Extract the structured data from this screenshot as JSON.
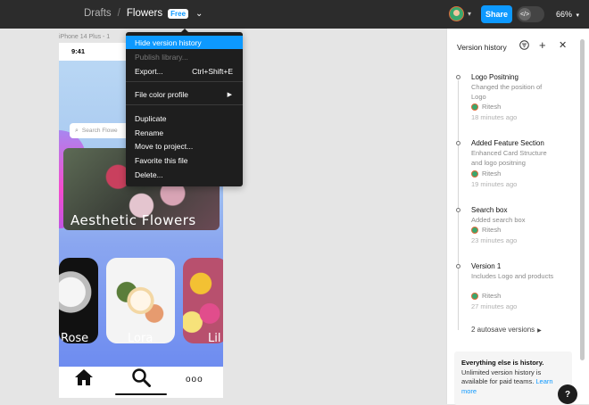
{
  "topbar": {
    "breadcrumb_parent": "Drafts",
    "separator": "/",
    "file_name": "Flowers",
    "plan_badge": "Free",
    "share_label": "Share",
    "zoom": "66%",
    "devmode_icon": "</>"
  },
  "canvas": {
    "frame_label": "iPhone 14 Plus - 1",
    "status_time": "9:41",
    "search_placeholder": "Search Flowe",
    "hero_title": "Aesthetic Flowers",
    "cards": [
      {
        "label": "Rose"
      },
      {
        "label": "Lora"
      },
      {
        "label": "Lil"
      }
    ]
  },
  "menu": {
    "items": [
      {
        "label": "Hide version history",
        "state": "active"
      },
      {
        "label": "Publish library...",
        "state": "disabled"
      },
      {
        "label": "Export...",
        "shortcut": "Ctrl+Shift+E"
      },
      {
        "label": "File color profile",
        "submenu": true
      },
      {
        "label": "Duplicate"
      },
      {
        "label": "Rename"
      },
      {
        "label": "Move to project..."
      },
      {
        "label": "Favorite this file"
      },
      {
        "label": "Delete..."
      }
    ]
  },
  "panel": {
    "title": "Version history",
    "entries": [
      {
        "title": "Logo Positning",
        "desc": "Changed the position of Logo",
        "user": "Ritesh",
        "time": "18 minutes ago"
      },
      {
        "title": "Added Feature Section",
        "desc": "Enhanced Card Structure and logo positning",
        "user": "Ritesh",
        "time": "19 minutes ago"
      },
      {
        "title": "Search box",
        "desc": "Added search box",
        "user": "Ritesh",
        "time": "23 minutes ago"
      },
      {
        "title": "Version 1",
        "desc": "Includes Logo and products",
        "user": "Ritesh",
        "time": "27 minutes ago"
      }
    ],
    "autosave": "2 autosave versions",
    "upsell_bold": "Everything else is history.",
    "upsell_text": "Unlimited version history is available for paid teams.",
    "upsell_link": "Learn more"
  },
  "help_label": "?",
  "colors": {
    "accent": "#0d99ff",
    "topbar": "#2c2c2c",
    "menu": "#1e1e1e"
  }
}
